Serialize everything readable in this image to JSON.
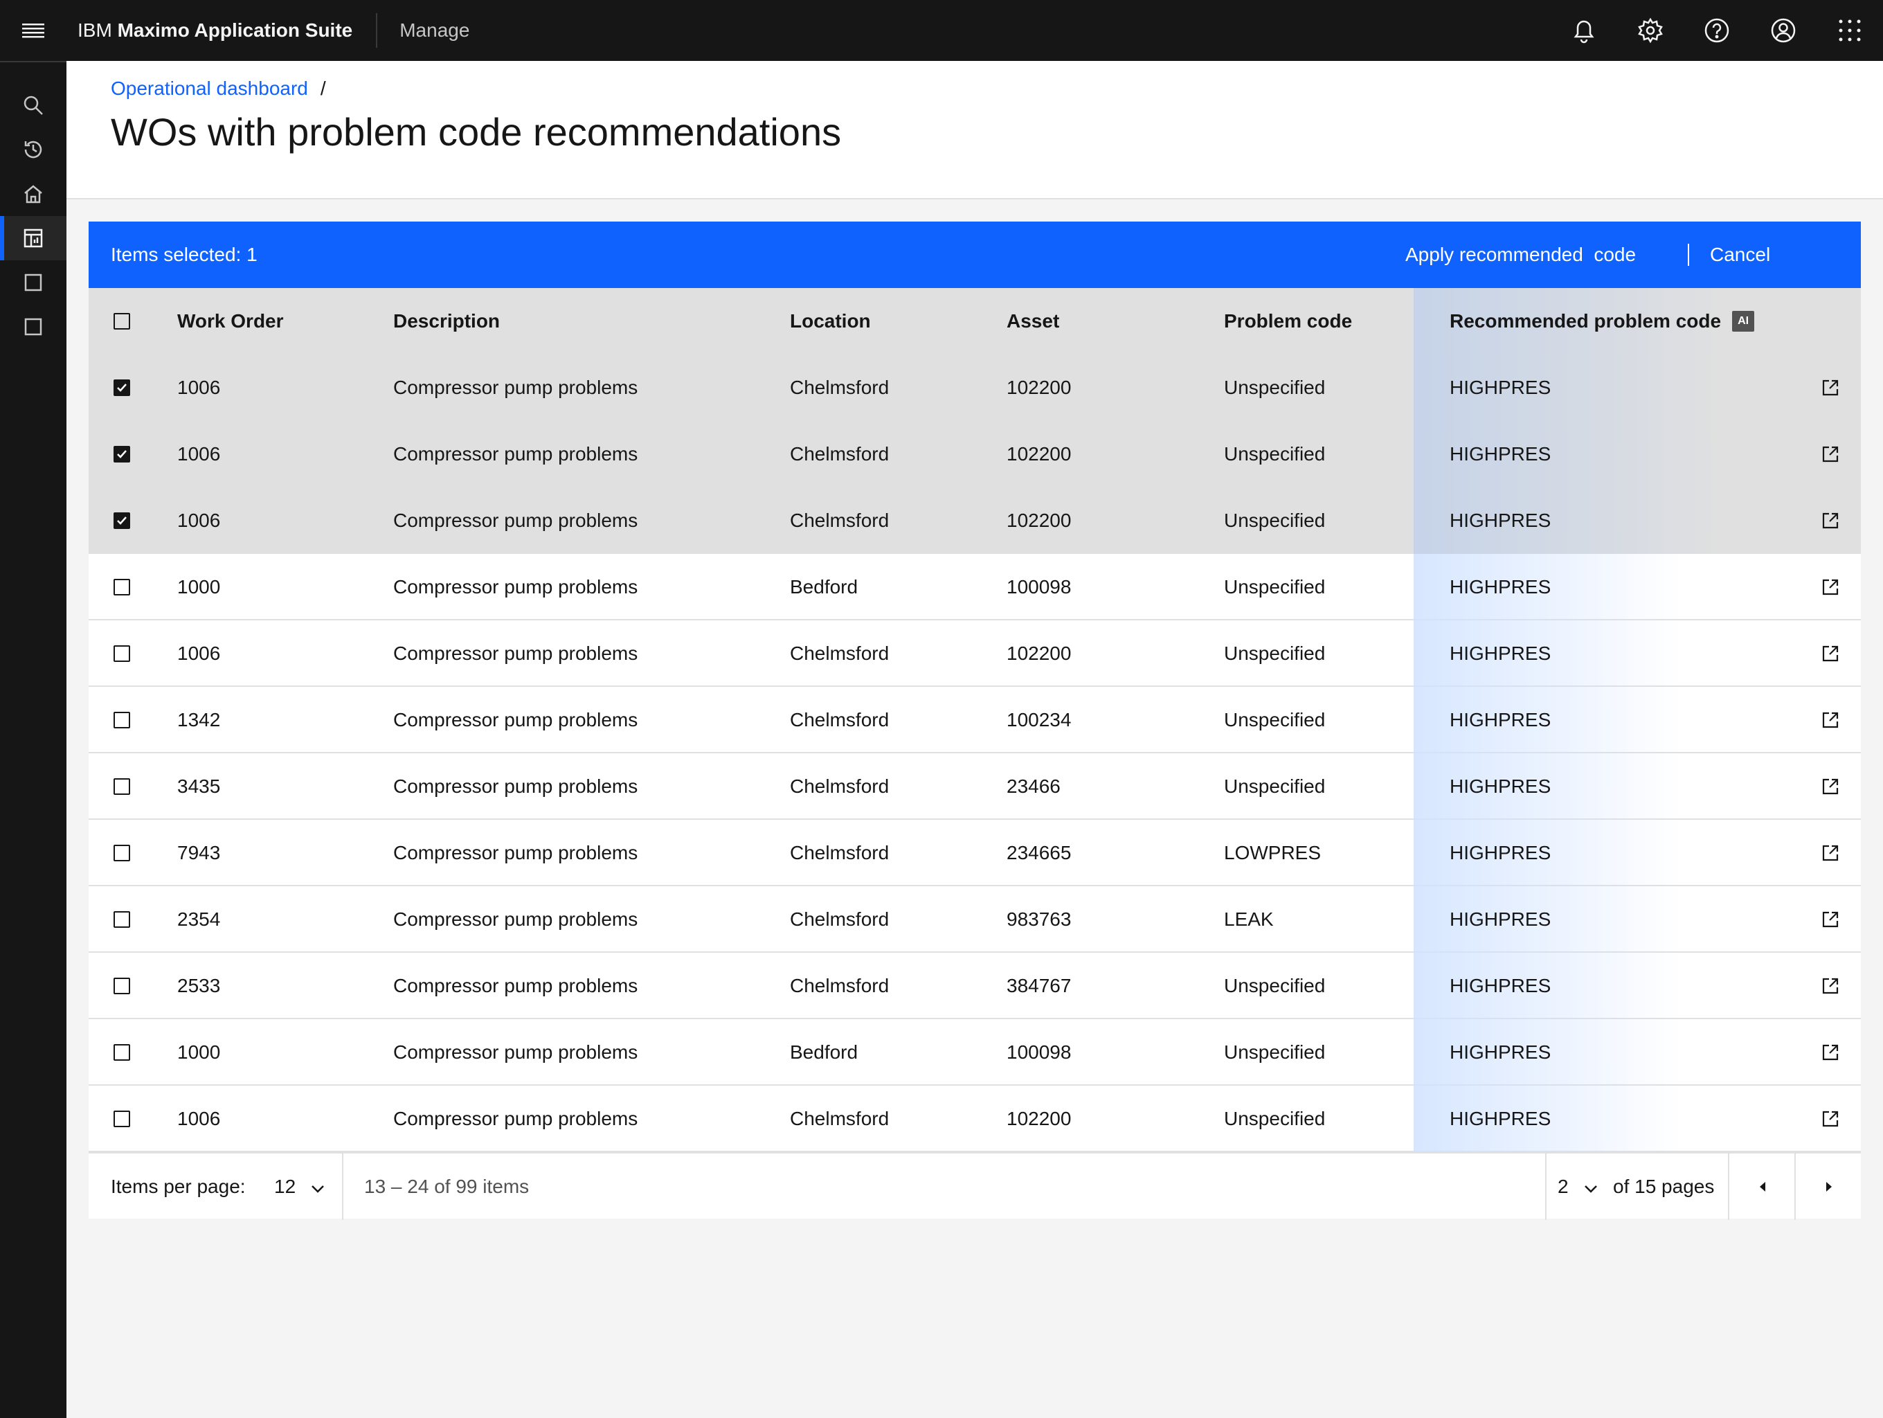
{
  "header": {
    "brand_prefix": "IBM",
    "brand_name": "Maximo Application Suite",
    "app_name": "Manage"
  },
  "breadcrumb": {
    "link": "Operational dashboard",
    "separator": "/"
  },
  "page_title": "WOs with problem code recommendations",
  "batch_actions": {
    "count_label": "Items selected: 1",
    "apply_label": "Apply recommended  code",
    "cancel_label": "Cancel"
  },
  "table": {
    "columns": {
      "work_order": "Work Order",
      "description": "Description",
      "location": "Location",
      "asset": "Asset",
      "problem_code": "Problem code",
      "recommended": "Recommended problem code",
      "ai_tag": "AI"
    },
    "rows": [
      {
        "wo": "1006",
        "desc": "Compressor pump problems",
        "loc": "Chelmsford",
        "asset": "102200",
        "prob": "Unspecified",
        "rec": "HIGHPRES",
        "checked": true
      },
      {
        "wo": "1006",
        "desc": "Compressor pump problems",
        "loc": "Chelmsford",
        "asset": "102200",
        "prob": "Unspecified",
        "rec": "HIGHPRES",
        "checked": true
      },
      {
        "wo": "1006",
        "desc": "Compressor pump problems",
        "loc": "Chelmsford",
        "asset": "102200",
        "prob": "Unspecified",
        "rec": "HIGHPRES",
        "checked": true
      },
      {
        "wo": "1000",
        "desc": "Compressor pump problems",
        "loc": "Bedford",
        "asset": "100098",
        "prob": "Unspecified",
        "rec": "HIGHPRES",
        "checked": false
      },
      {
        "wo": "1006",
        "desc": "Compressor pump problems",
        "loc": "Chelmsford",
        "asset": "102200",
        "prob": "Unspecified",
        "rec": "HIGHPRES",
        "checked": false
      },
      {
        "wo": "1342",
        "desc": "Compressor pump problems",
        "loc": "Chelmsford",
        "asset": "100234",
        "prob": "Unspecified",
        "rec": "HIGHPRES",
        "checked": false
      },
      {
        "wo": "3435",
        "desc": "Compressor pump problems",
        "loc": "Chelmsford",
        "asset": "23466",
        "prob": "Unspecified",
        "rec": "HIGHPRES",
        "checked": false
      },
      {
        "wo": "7943",
        "desc": "Compressor pump problems",
        "loc": "Chelmsford",
        "asset": "234665",
        "prob": "LOWPRES",
        "rec": "HIGHPRES",
        "checked": false
      },
      {
        "wo": "2354",
        "desc": "Compressor pump problems",
        "loc": "Chelmsford",
        "asset": "983763",
        "prob": "LEAK",
        "rec": "HIGHPRES",
        "checked": false
      },
      {
        "wo": "2533",
        "desc": "Compressor pump problems",
        "loc": "Chelmsford",
        "asset": "384767",
        "prob": "Unspecified",
        "rec": "HIGHPRES",
        "checked": false
      },
      {
        "wo": "1000",
        "desc": "Compressor pump problems",
        "loc": "Bedford",
        "asset": "100098",
        "prob": "Unspecified",
        "rec": "HIGHPRES",
        "checked": false
      },
      {
        "wo": "1006",
        "desc": "Compressor pump problems",
        "loc": "Chelmsford",
        "asset": "102200",
        "prob": "Unspecified",
        "rec": "HIGHPRES",
        "checked": false
      }
    ]
  },
  "pagination": {
    "items_per_page_label": "Items per page:",
    "items_per_page": "12",
    "range_text": "13 – 24 of 99 items",
    "current_page": "2",
    "of_pages": "of 15 pages"
  },
  "icons": {
    "menu": "hamburger-menu-icon",
    "notifications": "bell-icon",
    "settings": "gear-icon",
    "help": "help-icon",
    "user": "user-avatar-icon",
    "apps": "app-switcher-icon",
    "external": "launch-icon"
  },
  "colors": {
    "accent": "#0f62fe",
    "header_bg": "#161616",
    "selected_row": "#e0e0e0"
  }
}
